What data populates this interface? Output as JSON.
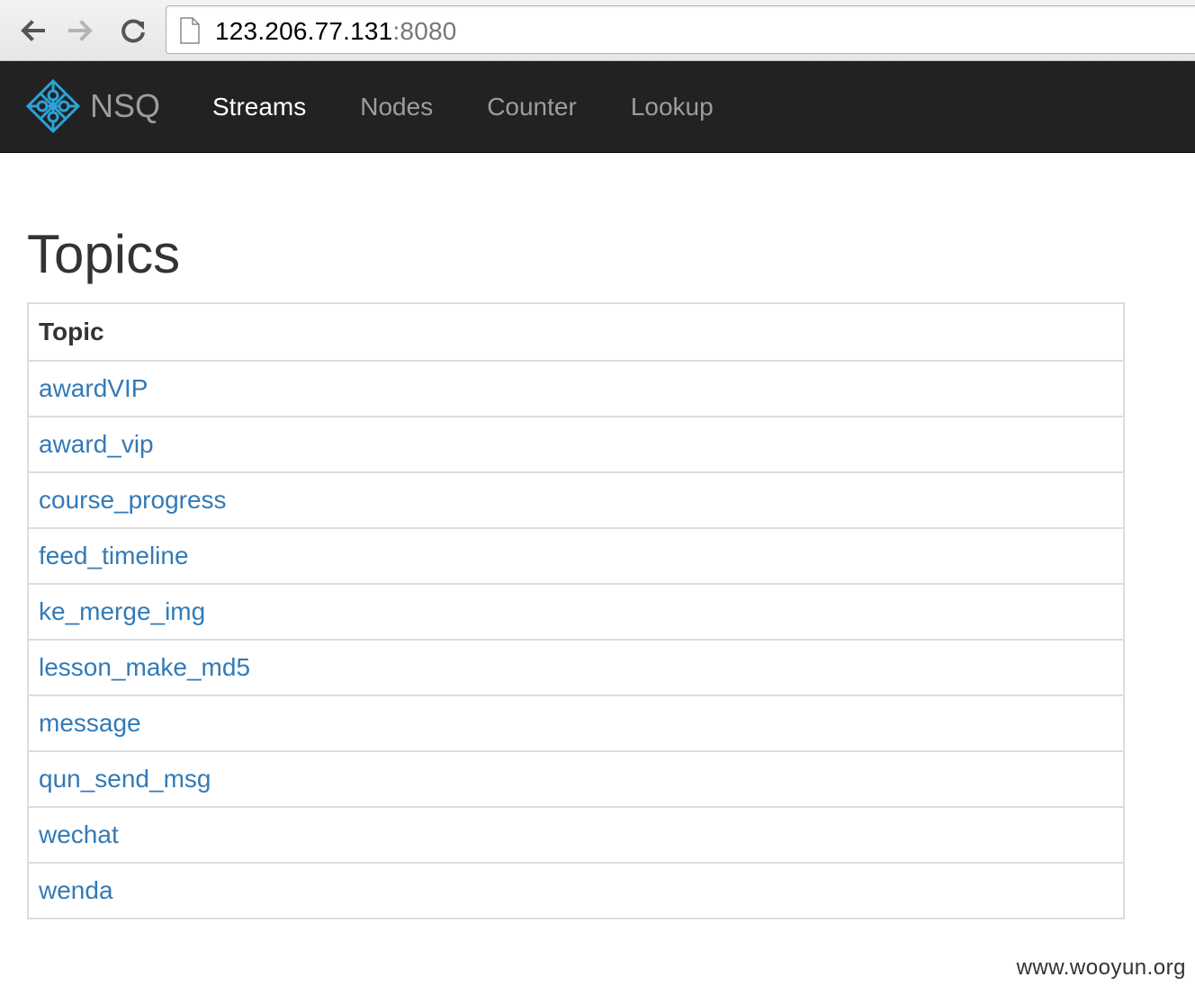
{
  "browser": {
    "url_host": "123.206.77.131",
    "url_port": ":8080"
  },
  "navbar": {
    "brand": "NSQ",
    "items": [
      {
        "label": "Streams"
      },
      {
        "label": "Nodes"
      },
      {
        "label": "Counter"
      },
      {
        "label": "Lookup"
      }
    ],
    "active": "Streams"
  },
  "main": {
    "title": "Topics",
    "table": {
      "header": "Topic",
      "rows": [
        "awardVIP",
        "award_vip",
        "course_progress",
        "feed_timeline",
        "ke_merge_img",
        "lesson_make_md5",
        "message",
        "qun_send_msg",
        "wechat",
        "wenda"
      ]
    }
  },
  "watermark": "www.wooyun.org",
  "colors": {
    "navbar_bg": "#222222",
    "link": "#337ab7",
    "logo": "#2aa3d9"
  }
}
